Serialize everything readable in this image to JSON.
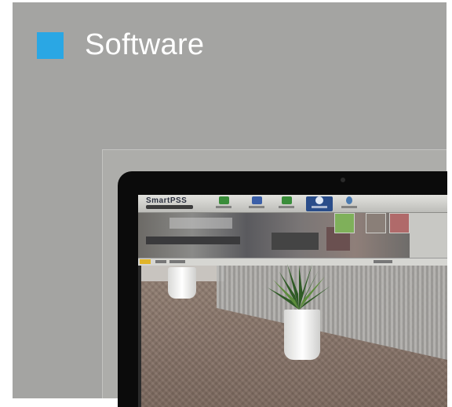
{
  "slide": {
    "title": "Software",
    "accent_color": "#2aa7e4",
    "background_color": "#a4a4a2"
  },
  "screen": {
    "app_name": "SmartPSS",
    "toolbar": [
      {
        "icon": "home-icon",
        "color": "#3a8d3a"
      },
      {
        "icon": "monitor-icon",
        "color": "#3b5fa8"
      },
      {
        "icon": "device-icon",
        "color": "#3a8d3a"
      },
      {
        "icon": "camera-icon",
        "color": "#2a4d8a",
        "active": true
      },
      {
        "icon": "play-icon",
        "color": "#4a7ab0"
      }
    ]
  }
}
